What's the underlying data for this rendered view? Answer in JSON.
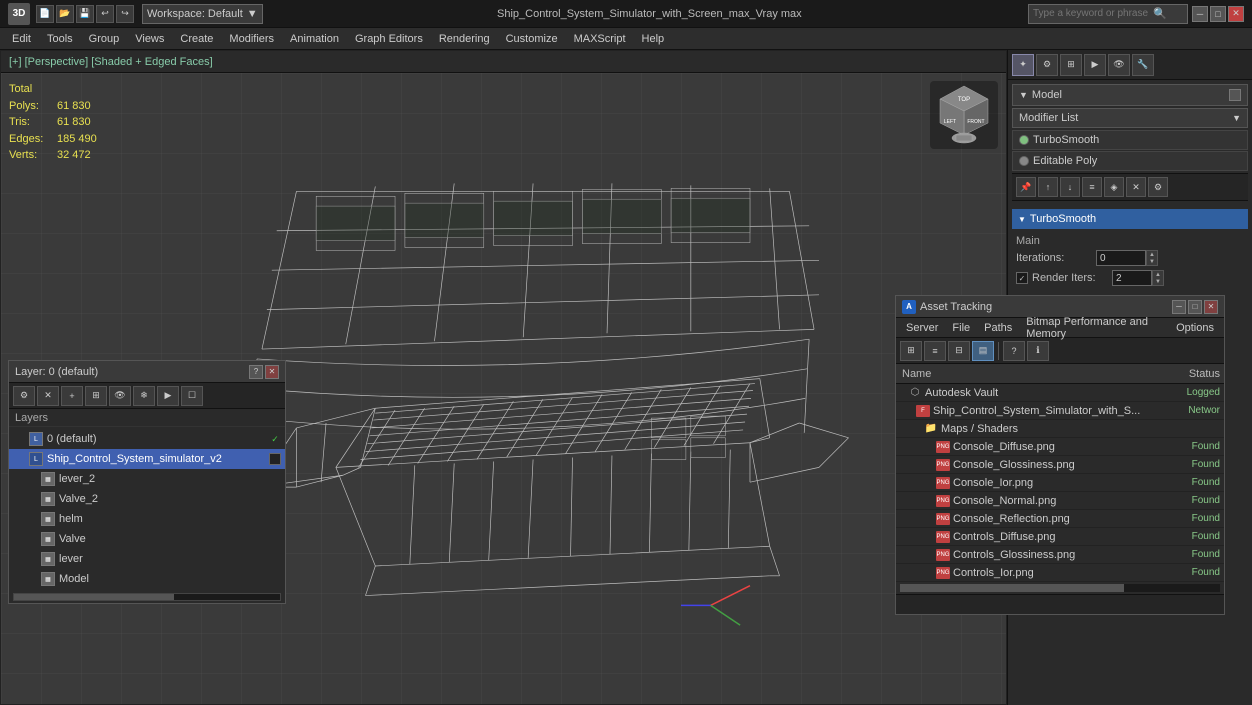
{
  "titlebar": {
    "logo": "3",
    "workspace_label": "Workspace: Default",
    "title": "Ship_Control_System_Simulator_with_Screen_max_Vray max",
    "search_placeholder": "Type a keyword or phrase",
    "min_btn": "─",
    "max_btn": "□",
    "close_btn": "✕"
  },
  "menubar": {
    "items": [
      "Edit",
      "Tools",
      "Group",
      "Views",
      "Create",
      "Modifiers",
      "Animation",
      "Graph Editors",
      "Rendering",
      "Customize",
      "MAXScript",
      "Help"
    ]
  },
  "viewport": {
    "header": "[+] [Perspective] [Shaded + Edged Faces]",
    "stats": {
      "polys_label": "Polys:",
      "polys_value": "61 830",
      "tris_label": "Tris:",
      "tris_value": "61 830",
      "edges_label": "Edges:",
      "edges_value": "185 490",
      "verts_label": "Verts:",
      "verts_value": "32 472",
      "total_label": "Total"
    }
  },
  "right_panel": {
    "model_label": "Model",
    "modifier_list_label": "Modifier List",
    "modifiers": [
      {
        "name": "TurboSmooth",
        "active": true
      },
      {
        "name": "Editable Poly",
        "active": false
      }
    ],
    "turbosmooth": {
      "header": "TurboSmooth",
      "main_label": "Main",
      "iterations_label": "Iterations:",
      "iterations_value": "0",
      "render_iters_label": "Render Iters:",
      "render_iters_value": "2",
      "render_iters_checked": true
    }
  },
  "layer_panel": {
    "title": "Layer: 0 (default)",
    "question_btn": "?",
    "close_btn": "✕",
    "section_label": "Layers",
    "items": [
      {
        "id": "default",
        "name": "0 (default)",
        "indent": 0,
        "checked": true,
        "active": false
      },
      {
        "id": "ship",
        "name": "Ship_Control_System_simulator_v2",
        "indent": 1,
        "checked": false,
        "active": true
      },
      {
        "id": "lever2",
        "name": "lever_2",
        "indent": 2,
        "checked": false,
        "active": false
      },
      {
        "id": "valve2",
        "name": "Valve_2",
        "indent": 2,
        "checked": false,
        "active": false
      },
      {
        "id": "helm",
        "name": "helm",
        "indent": 2,
        "checked": false,
        "active": false
      },
      {
        "id": "valve",
        "name": "Valve",
        "indent": 2,
        "checked": false,
        "active": false
      },
      {
        "id": "lever",
        "name": "lever",
        "indent": 2,
        "checked": false,
        "active": false
      },
      {
        "id": "model",
        "name": "Model",
        "indent": 2,
        "checked": false,
        "active": false
      }
    ]
  },
  "asset_panel": {
    "title": "Asset Tracking",
    "menu_items": [
      "Server",
      "File",
      "Paths",
      "Bitmap Performance and Memory",
      "Options"
    ],
    "columns": {
      "name": "Name",
      "status": "Status"
    },
    "rows": [
      {
        "id": "vault",
        "name": "Autodesk Vault",
        "type": "vault",
        "status": "Logged",
        "indent": 0
      },
      {
        "id": "ship_file",
        "name": "Ship_Control_System_Simulator_with_S...",
        "type": "file",
        "status": "Networ",
        "indent": 1
      },
      {
        "id": "maps_folder",
        "name": "Maps / Shaders",
        "type": "folder",
        "status": "",
        "indent": 2
      },
      {
        "id": "console_diffuse",
        "name": "Console_Diffuse.png",
        "type": "texture",
        "status": "Found",
        "indent": 3
      },
      {
        "id": "console_glossiness",
        "name": "Console_Glossiness.png",
        "type": "texture",
        "status": "Found",
        "indent": 3
      },
      {
        "id": "console_ior",
        "name": "Console_Ior.png",
        "type": "texture",
        "status": "Found",
        "indent": 3
      },
      {
        "id": "console_normal",
        "name": "Console_Normal.png",
        "type": "texture",
        "status": "Found",
        "indent": 3
      },
      {
        "id": "console_reflection",
        "name": "Console_Reflection.png",
        "type": "texture",
        "status": "Found",
        "indent": 3
      },
      {
        "id": "controls_diffuse",
        "name": "Controls_Diffuse.png",
        "type": "texture",
        "status": "Found",
        "indent": 3
      },
      {
        "id": "controls_glossiness",
        "name": "Controls_Glossiness.png",
        "type": "texture",
        "status": "Found",
        "indent": 3
      },
      {
        "id": "controls_ior",
        "name": "Controls_Ior.png",
        "type": "texture",
        "status": "Found",
        "indent": 3
      }
    ]
  }
}
